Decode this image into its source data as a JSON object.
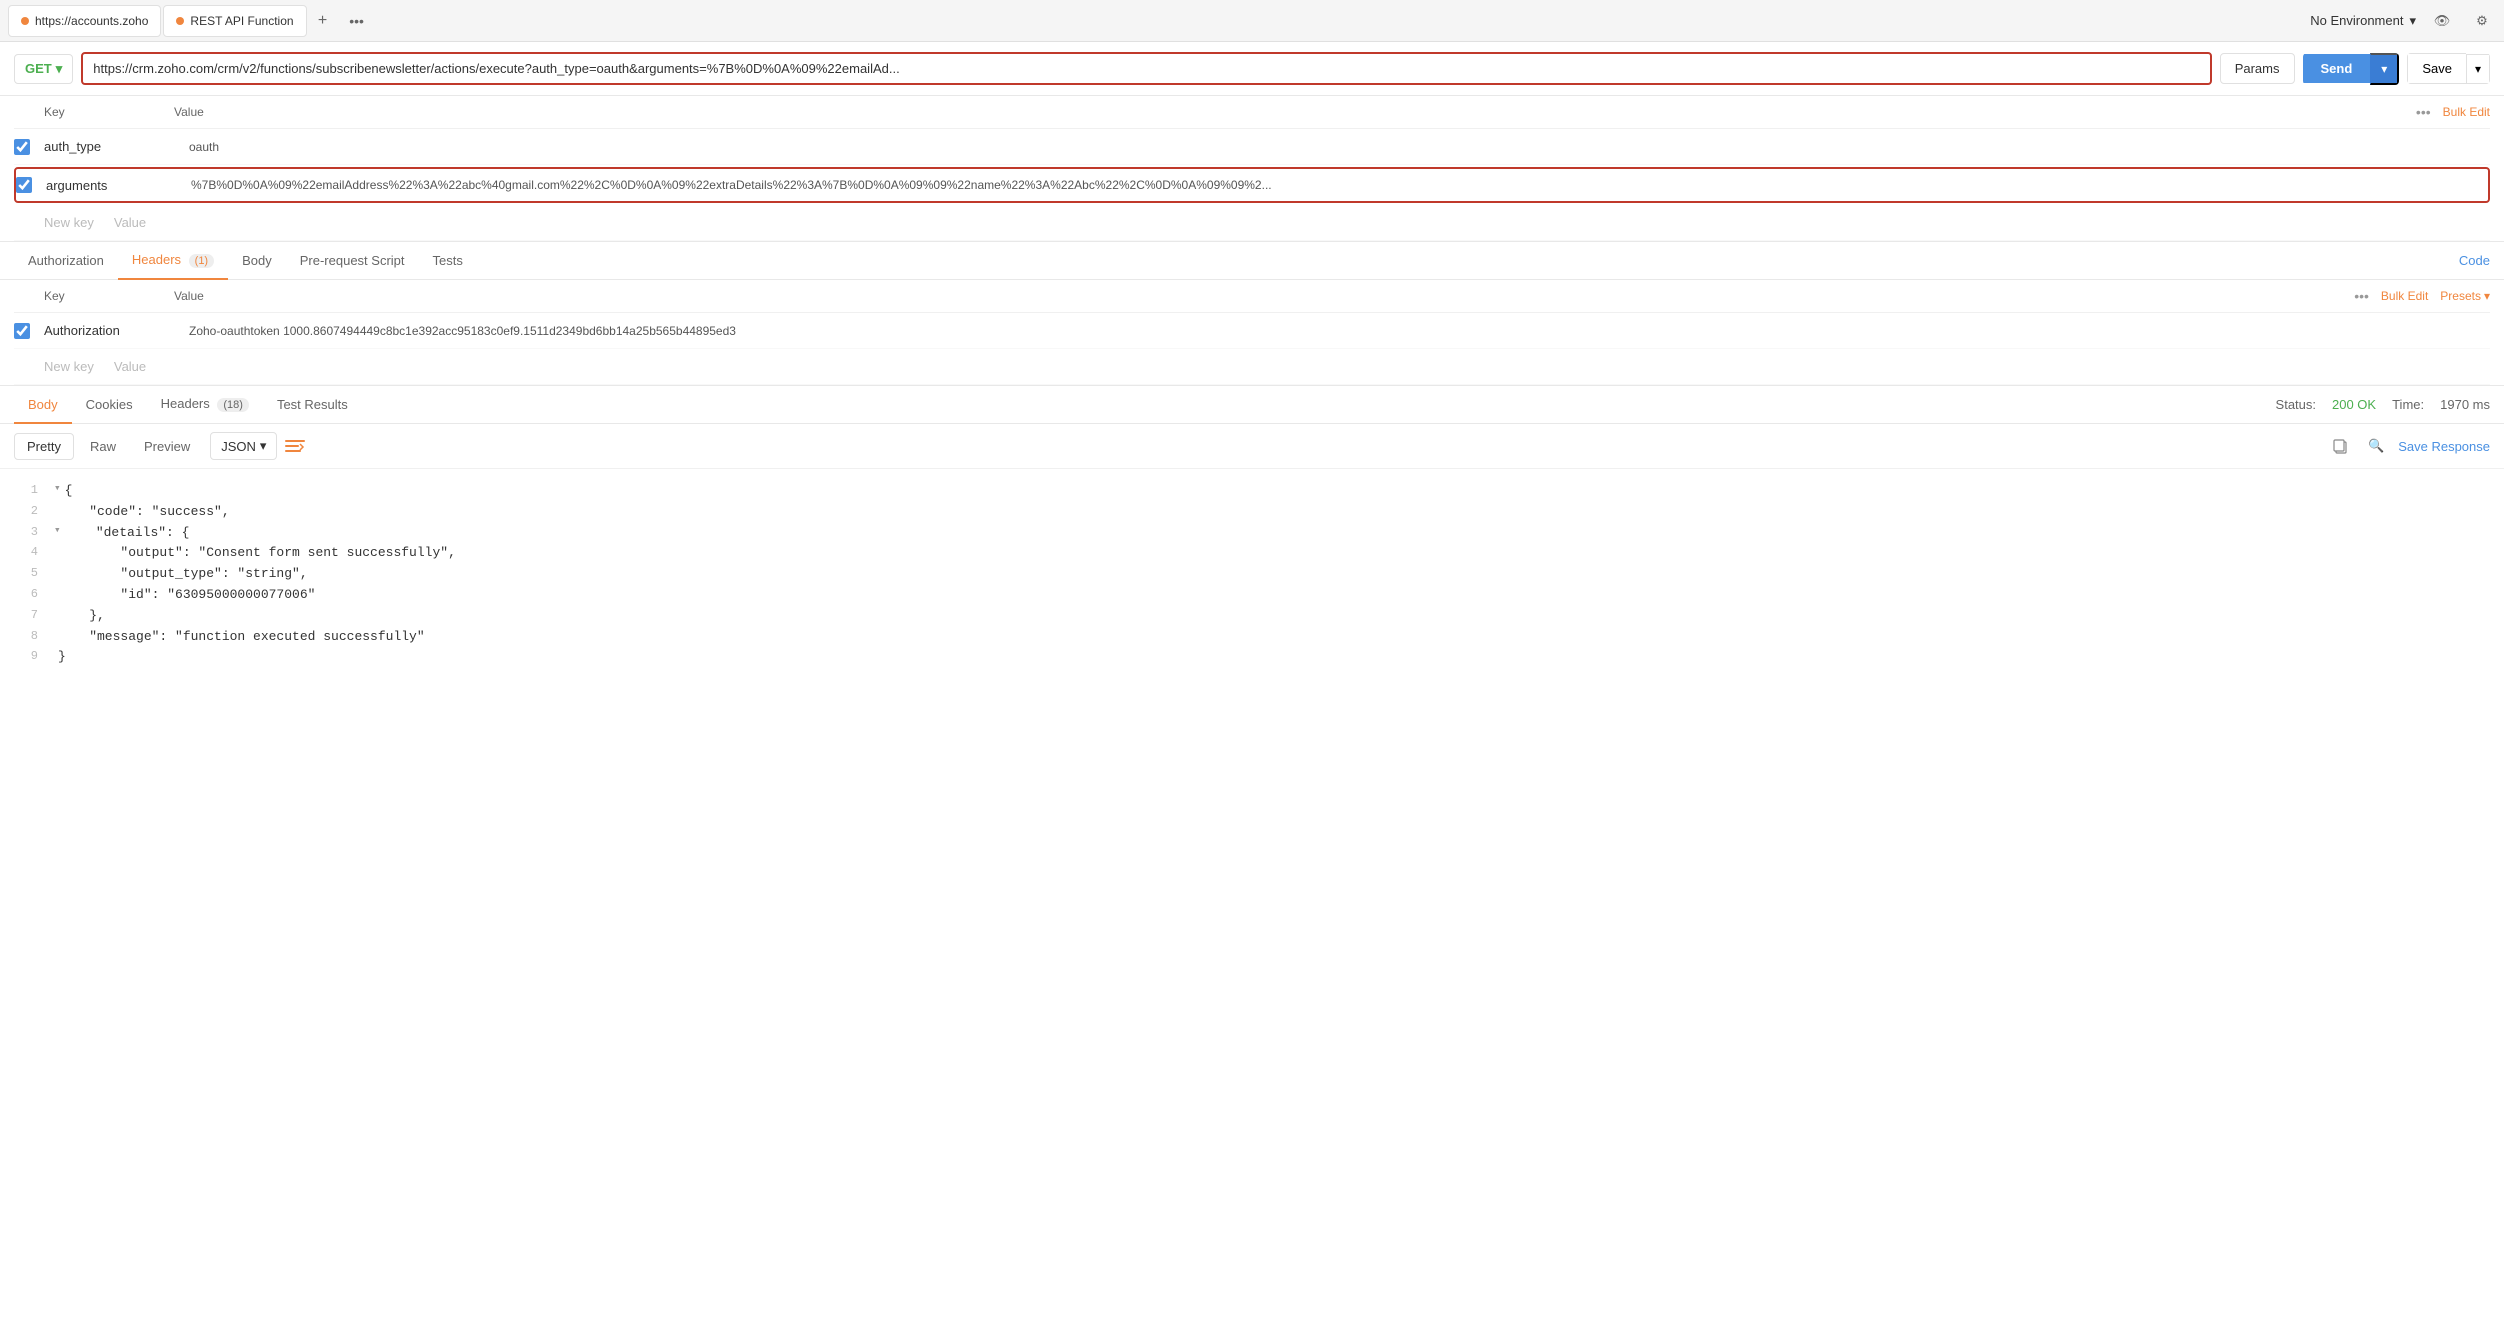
{
  "tabBar": {
    "tabs": [
      {
        "id": "tab1",
        "label": "https://accounts.zoho",
        "dotColor": "orange"
      },
      {
        "id": "tab2",
        "label": "REST API Function",
        "dotColor": "orange"
      }
    ],
    "addLabel": "+",
    "moreLabel": "•••",
    "environment": {
      "label": "No Environment",
      "chevron": "▾"
    },
    "eyeIcon": "👁",
    "gearIcon": "⚙"
  },
  "requestBar": {
    "method": "GET",
    "chevron": "▾",
    "url": "https://crm.zoho.com/crm/v2/functions/subscribenewsletter/actions/execute?auth_type=oauth&arguments=%7B%0D%0A%09%22emailAd...",
    "paramsLabel": "Params",
    "sendLabel": "Send",
    "sendChevron": "▾",
    "saveLabel": "Save",
    "saveChevron": "▾"
  },
  "paramsSection": {
    "keyHeader": "Key",
    "valueHeader": "Value",
    "moreLabel": "•••",
    "bulkEditLabel": "Bulk Edit",
    "rows": [
      {
        "checked": true,
        "key": "auth_type",
        "value": "oauth"
      },
      {
        "checked": true,
        "key": "arguments",
        "value": "%7B%0D%0A%09%22emailAddress%22%3A%22abc%40gmail.com%22%2C%0D%0A%09%22extraDetails%22%3A%7B%0D%0A%09%09%22name%22%3A%22Abc%22%2C%0D%0A%09%09%2..."
      }
    ],
    "newKeyPlaceholder": "New key",
    "newValuePlaceholder": "Value"
  },
  "requestTabs": {
    "items": [
      {
        "id": "authorization",
        "label": "Authorization",
        "badge": null,
        "active": false
      },
      {
        "id": "headers",
        "label": "Headers",
        "badge": "(1)",
        "active": true
      },
      {
        "id": "body",
        "label": "Body",
        "badge": null,
        "active": false
      },
      {
        "id": "prerequest",
        "label": "Pre-request Script",
        "badge": null,
        "active": false
      },
      {
        "id": "tests",
        "label": "Tests",
        "badge": null,
        "active": false
      }
    ],
    "codeLabel": "Code"
  },
  "headersSection": {
    "keyHeader": "Key",
    "valueHeader": "Value",
    "moreLabel": "•••",
    "bulkEditLabel": "Bulk Edit",
    "presetsLabel": "Presets",
    "presetsChevron": "▾",
    "rows": [
      {
        "checked": true,
        "key": "Authorization",
        "value": "Zoho-oauthtoken 1000.8607494449c8bc1e392acc95183c0ef9.1511d2349bd6bb14a25b565b44895ed3"
      }
    ],
    "newKeyPlaceholder": "New key",
    "newValuePlaceholder": "Value"
  },
  "responseTabs": {
    "items": [
      {
        "id": "body",
        "label": "Body",
        "active": true
      },
      {
        "id": "cookies",
        "label": "Cookies",
        "active": false
      },
      {
        "id": "headers",
        "label": "Headers",
        "badge": "(18)",
        "active": false
      },
      {
        "id": "testresults",
        "label": "Test Results",
        "active": false
      }
    ],
    "statusLabel": "Status:",
    "statusValue": "200 OK",
    "timeLabel": "Time:",
    "timeValue": "1970 ms"
  },
  "responseBodyToolbar": {
    "formats": [
      {
        "id": "pretty",
        "label": "Pretty",
        "active": true
      },
      {
        "id": "raw",
        "label": "Raw",
        "active": false
      },
      {
        "id": "preview",
        "label": "Preview",
        "active": false
      }
    ],
    "jsonLabel": "JSON",
    "jsonChevron": "▾",
    "wrapIcon": "≡",
    "copyIcon": "⧉",
    "searchIcon": "🔍",
    "saveResponseLabel": "Save Response"
  },
  "responseBody": {
    "lines": [
      {
        "num": "1",
        "fold": "▾",
        "content": "{",
        "type": "brace"
      },
      {
        "num": "2",
        "fold": "",
        "content": "    \"code\": \"success\",",
        "type": "code"
      },
      {
        "num": "3",
        "fold": "▾",
        "content": "    \"details\": {",
        "type": "code"
      },
      {
        "num": "4",
        "fold": "",
        "content": "        \"output\": \"Consent form sent successfully\",",
        "type": "code"
      },
      {
        "num": "5",
        "fold": "",
        "content": "        \"output_type\": \"string\",",
        "type": "code"
      },
      {
        "num": "6",
        "fold": "",
        "content": "        \"id\": \"63095000000077006\"",
        "type": "code"
      },
      {
        "num": "7",
        "fold": "",
        "content": "    },",
        "type": "code"
      },
      {
        "num": "8",
        "fold": "",
        "content": "    \"message\": \"function executed successfully\"",
        "type": "code"
      },
      {
        "num": "9",
        "fold": "",
        "content": "}",
        "type": "brace"
      }
    ]
  }
}
